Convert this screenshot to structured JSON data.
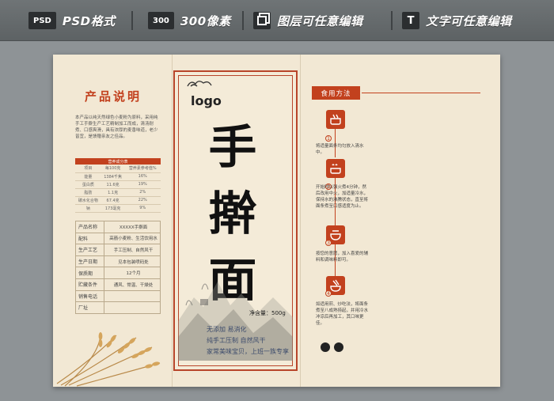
{
  "banner": {
    "psd_badge": "PSD",
    "psd_text": "PSD格式",
    "res_badge": "300",
    "res_text": "300像素",
    "layer_text": "图层可任意编辑",
    "text_badge": "T",
    "text_text": "文字可任意编辑"
  },
  "left": {
    "title": "产品说明",
    "description": "本产品以纯天然绿色小麦粉为原料，采用纯手工手擀生产工艺精制加工而成，清汤耐煮、口感爽滑，具有浓厚的麦香味道，老少皆宜，是馈赠亲友之佳品。",
    "nutrition": {
      "header": "营养成分表",
      "columns": [
        "项目",
        "每100克",
        "营养素参考值%"
      ],
      "rows": [
        [
          "能量",
          "1384千焦",
          "16%"
        ],
        [
          "蛋白质",
          "11.6克",
          "19%"
        ],
        [
          "脂肪",
          "1.1克",
          "2%"
        ],
        [
          "碳水化合物",
          "67.4克",
          "22%"
        ],
        [
          "钠",
          "173毫克",
          "9%"
        ]
      ]
    },
    "info": [
      [
        "产品名称",
        "XXXXX手擀面"
      ],
      [
        "配料",
        "高筋小麦粉、生活饮用水"
      ],
      [
        "生产工艺",
        "手工压制、自然风干"
      ],
      [
        "生产日期",
        "见本包装喷码处"
      ],
      [
        "保质期",
        "12个月"
      ],
      [
        "贮藏条件",
        "通风、常温、干燥处"
      ],
      [
        "销售电话",
        ""
      ],
      [
        "厂址",
        ""
      ]
    ]
  },
  "center": {
    "logo": "logo",
    "char1": "手",
    "char2": "擀",
    "char3": "面",
    "net": "净含量：500g",
    "feature1": "无添加  易消化",
    "feature2": "纯手工压制  自然风干",
    "feature3": "家常美味宝贝，上班一族专享"
  },
  "right": {
    "title": "食用方法",
    "steps": [
      {
        "num": "1",
        "text": "将适量面条均匀放入清水中。"
      },
      {
        "num": "2",
        "text": "开始时以强火煮4分钟，然后改用中火，加适量冷水，保持水的沸腾状态，直至将面条煮至口感适度为止。"
      },
      {
        "num": "3",
        "text": "按您的意愿，加入喜爱的辅料和调味料即可。"
      },
      {
        "num": "4",
        "text": "如适用煎、炒吃法，将面条煮至八成熟捞起，并用冷水冲凉后再加工，其口味更佳。"
      }
    ]
  },
  "colors": {
    "accent": "#c2411e",
    "paper": "#f2e8d4"
  }
}
